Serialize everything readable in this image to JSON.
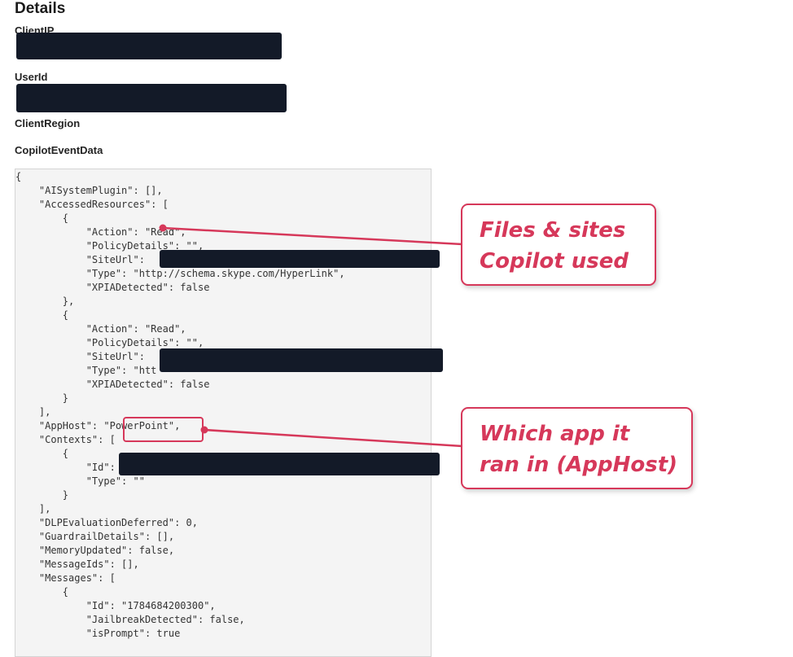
{
  "details": {
    "title": "Details",
    "client_ip_label": "ClientIP",
    "user_id_label": "UserId",
    "client_region_label": "ClientRegion",
    "copilot_event_data_label": "CopilotEventData"
  },
  "code_lines": [
    "{",
    "    \"AISystemPlugin\": [],",
    "    \"AccessedResources\": [",
    "        {",
    "            \"Action\": \"Read\",",
    "            \"PolicyDetails\": \"\",",
    "            \"SiteUrl\":",
    "            \"Type\": \"http://schema.skype.com/HyperLink\",",
    "            \"XPIADetected\": false",
    "        },",
    "        {",
    "            \"Action\": \"Read\",",
    "            \"PolicyDetails\": \"\",",
    "            \"SiteUrl\":",
    "            \"Type\": \"htt",
    "            \"XPIADetected\": false",
    "        }",
    "    ],",
    "    \"AppHost\": \"PowerPoint\",",
    "    \"Contexts\": [",
    "        {",
    "            \"Id\":",
    "            \"Type\": \"\"",
    "        }",
    "    ],",
    "    \"DLPEvaluationDeferred\": 0,",
    "    \"GuardrailDetails\": [],",
    "    \"MemoryUpdated\": false,",
    "    \"MessageIds\": [],",
    "    \"Messages\": [",
    "        {",
    "            \"Id\": \"1784684200300\",",
    "            \"JailbreakDetected\": false,",
    "            \"isPrompt\": true"
  ],
  "annotations": {
    "resources_callout": {
      "line1": "Files & sites",
      "line2": "Copilot used"
    },
    "apphost_callout": {
      "line1": "Which app it",
      "line2": "ran in (AppHost)"
    }
  },
  "colors": {
    "annotation": "#d6385a",
    "redaction": "#131a28",
    "code_background": "#f4f4f4"
  }
}
